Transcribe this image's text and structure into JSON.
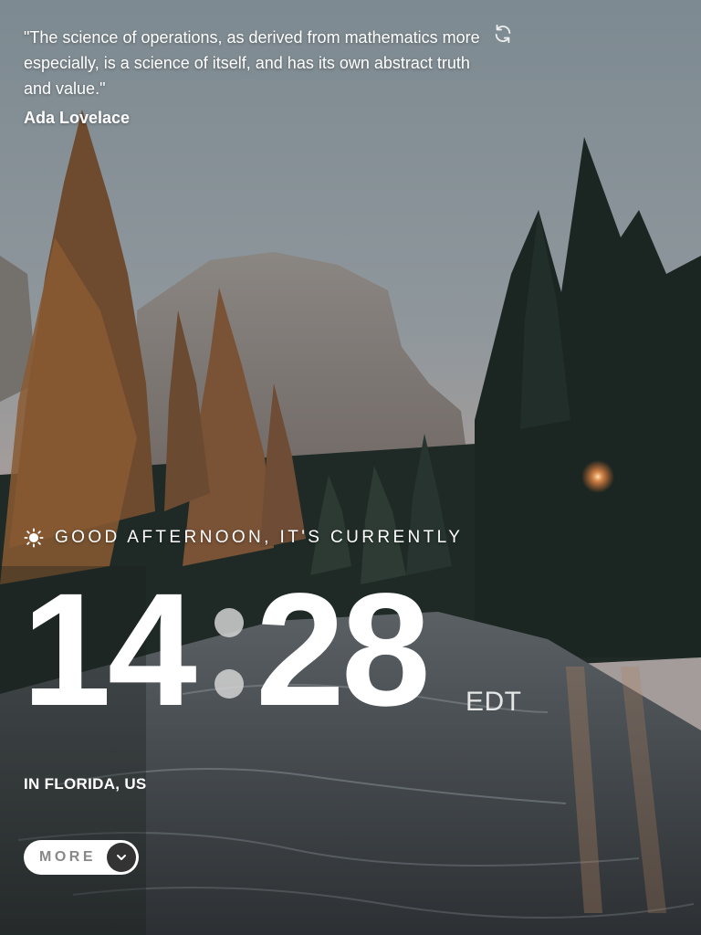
{
  "quote": {
    "text": "\"The science of operations, as derived from mathematics more especially, is a science of itself, and has its own abstract truth and value.\"",
    "author": "Ada Lovelace",
    "refresh_icon": "refresh-icon"
  },
  "greeting": {
    "icon": "sun-icon",
    "text": "GOOD AFTERNOON, IT'S CURRENTLY"
  },
  "clock": {
    "hours": "14",
    "minutes": "28",
    "timezone": "EDT"
  },
  "location": {
    "text": "IN FLORIDA, US"
  },
  "more_button": {
    "label": "MORE",
    "icon": "chevron-down-icon"
  }
}
